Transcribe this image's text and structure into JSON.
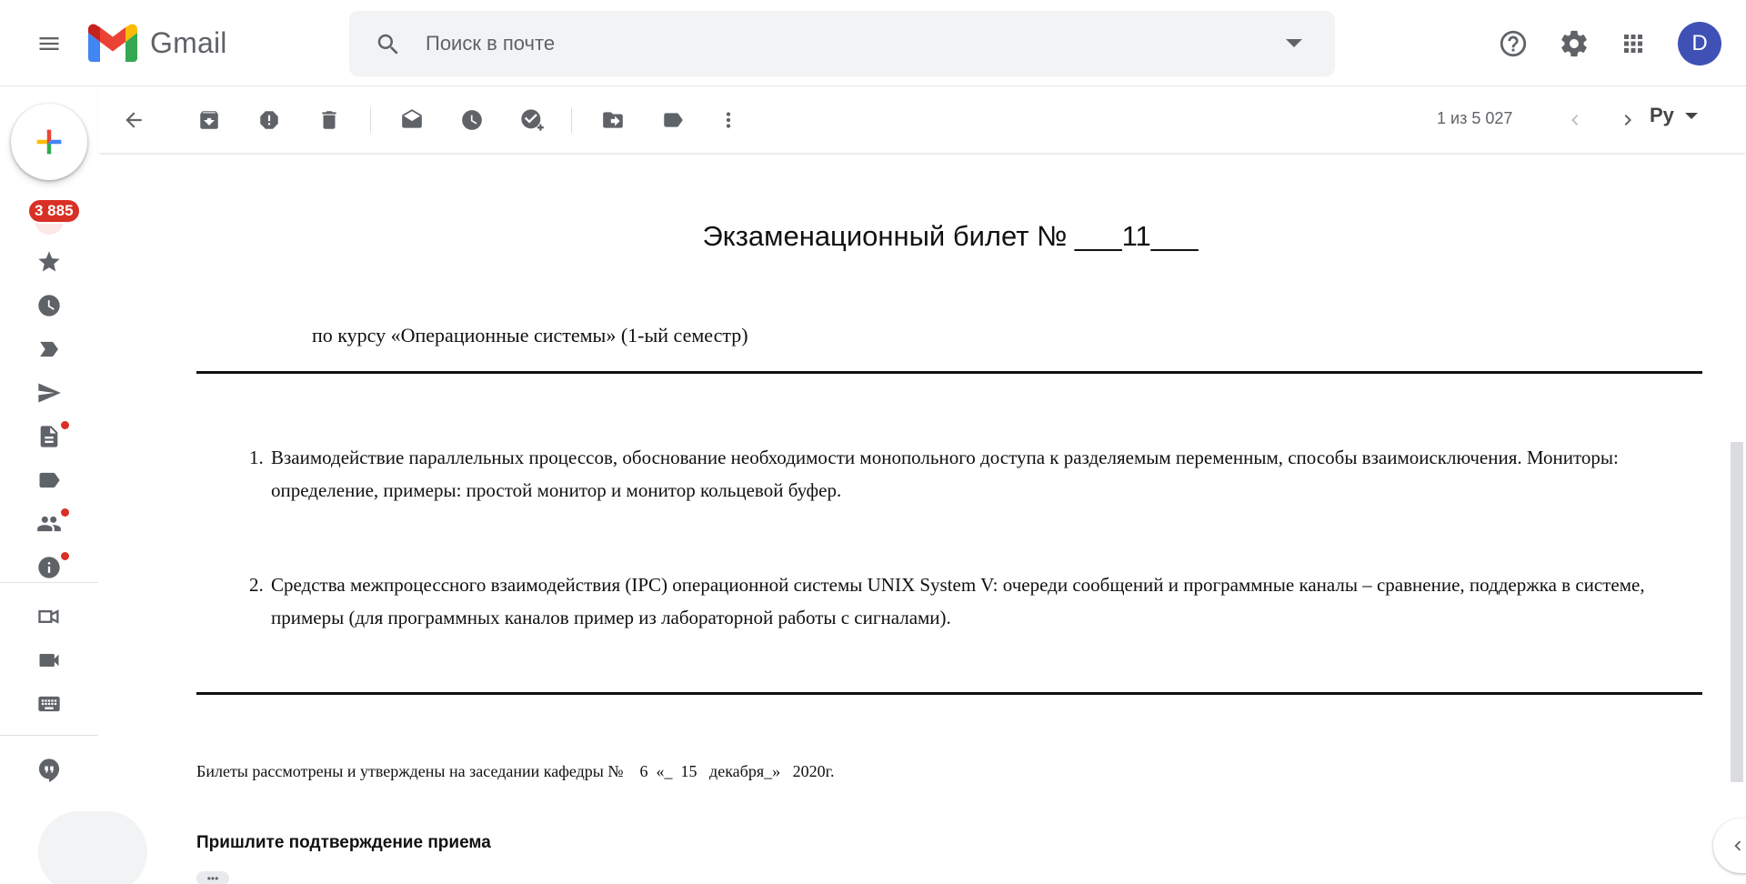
{
  "app": {
    "name": "Gmail",
    "brand_color": "#ea4335",
    "accent": "#1a73e8"
  },
  "header": {
    "search_placeholder": "Поиск в почте",
    "avatar_letter": "D",
    "avatar_color": "#3f51b5"
  },
  "sidebar": {
    "inbox_badge": "3 885",
    "icons": [
      "inbox-icon",
      "star-icon",
      "clock-icon",
      "important-icon",
      "send-icon",
      "draft-icon",
      "label-icon",
      "people-icon",
      "info-icon",
      "meet-new-icon",
      "video-icon",
      "keyboard-icon",
      "chat-icon"
    ]
  },
  "toolbar": {
    "pager": "1 из 5 027",
    "lang": "Ру"
  },
  "document": {
    "title": "Экзаменационный билет № ___11___",
    "course": "по курсу «Операционные системы» (1-ый семестр)",
    "questions": [
      {
        "num": "1.",
        "text": "Взаимодействие параллельных процессов, обоснование необходимости монопольного доступа к разделяемым переменным, способы взаимоисключения. Мониторы: определение, примеры: простой монитор и монитор кольцевой буфер."
      },
      {
        "num": "2.",
        "text": "Средства межпроцессного взаимодействия (IPC) операционной системы UNIX System V: очереди сообщений и программные каналы – сравнение, поддержка в системе, примеры (для программных каналов пример из лабораторной работы с сигналами)."
      }
    ],
    "approval": "Билеты рассмотрены и утверждены на заседании кафедры №    6  «_  15   декабря_»   2020г.",
    "confirm": "Пришлите подтверждение приема",
    "ellipsis": "•••"
  }
}
